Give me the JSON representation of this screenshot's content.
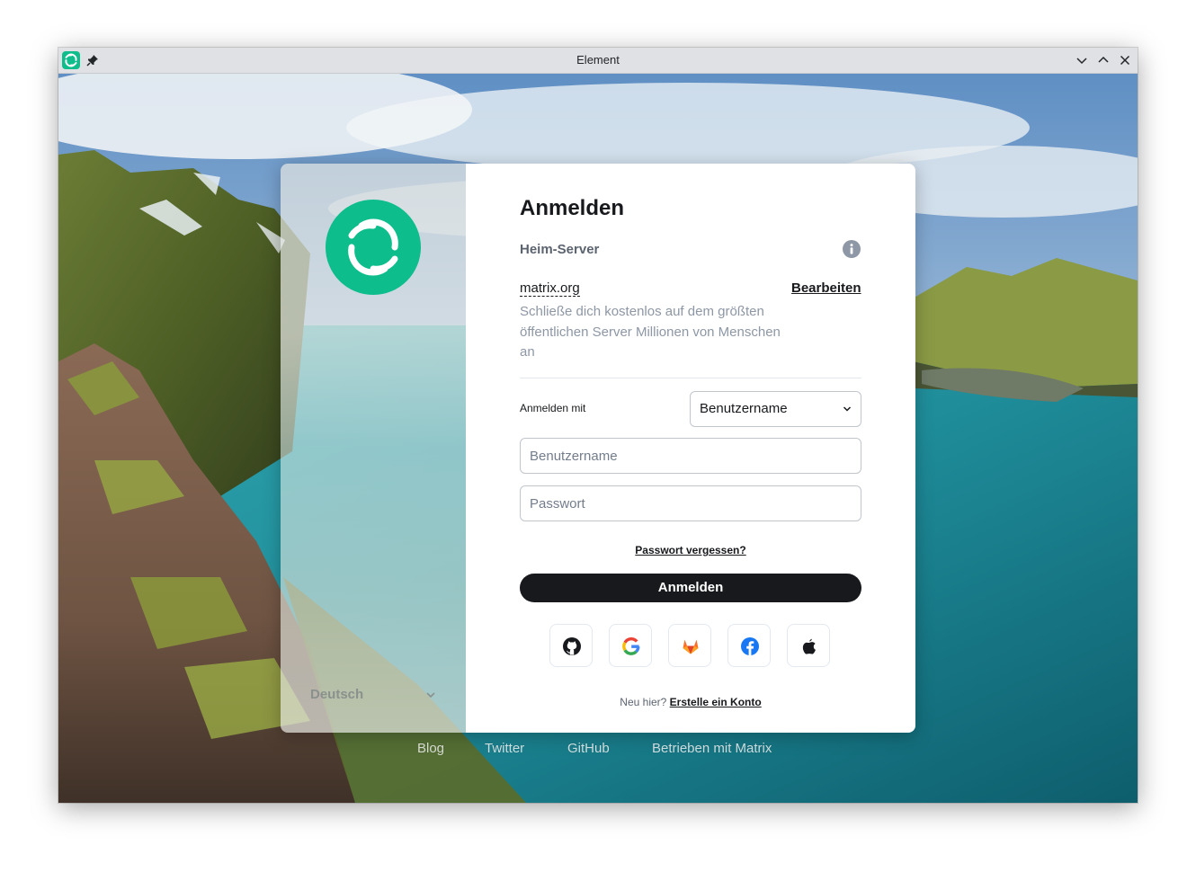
{
  "window": {
    "title": "Element"
  },
  "language": {
    "selected": "Deutsch"
  },
  "auth": {
    "heading": "Anmelden",
    "homeserver_label": "Heim-Server",
    "server_name": "matrix.org",
    "edit_label": "Bearbeiten",
    "server_description": "Schließe dich kostenlos auf dem größten öffentlichen Server Millionen von Menschen an",
    "login_with_label": "Anmelden mit",
    "login_with_selected": "Benutzername",
    "username_placeholder": "Benutzername",
    "password_placeholder": "Passwort",
    "forgot_password": "Passwort vergessen?",
    "submit_label": "Anmelden",
    "sso_providers": [
      "github",
      "google",
      "gitlab",
      "facebook",
      "apple"
    ],
    "signup_prompt": "Neu hier?",
    "signup_link": "Erstelle ein Konto"
  },
  "footer": {
    "links": [
      "Blog",
      "Twitter",
      "GitHub",
      "Betrieben mit Matrix"
    ]
  },
  "colors": {
    "brand": "#0dbd8b",
    "primary_button": "#17191c",
    "secondary_text": "#8d97a5"
  }
}
